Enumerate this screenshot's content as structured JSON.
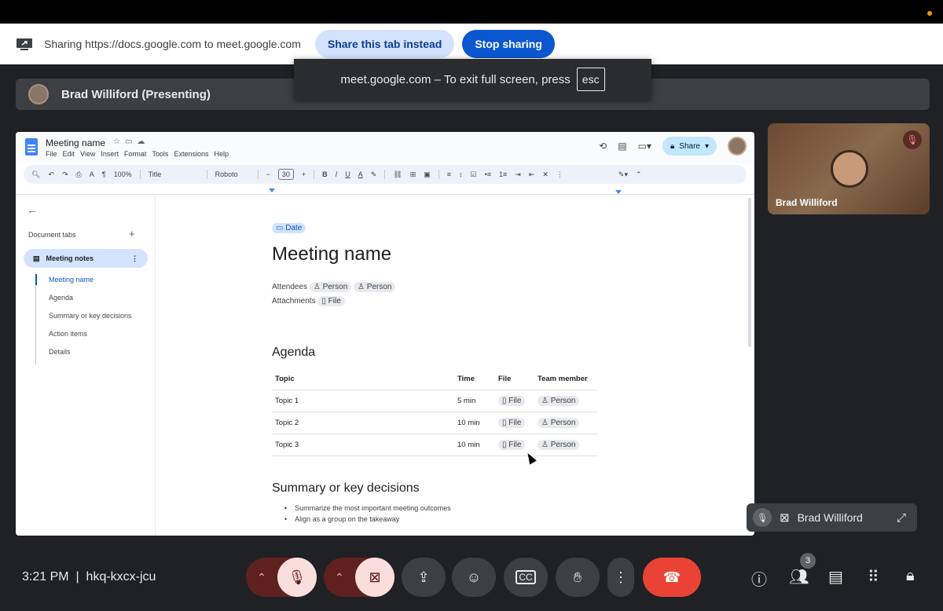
{
  "sharing_bar": {
    "text": "Sharing https://docs.google.com to meet.google.com",
    "share_tab_label": "Share this tab instead",
    "stop_label": "Stop sharing"
  },
  "presenter": {
    "name": "Brad Williford (Presenting)"
  },
  "fullscreen_toast": {
    "text": "meet.google.com – To exit full screen, press",
    "key": "esc"
  },
  "docs": {
    "title": "Meeting name",
    "menu": [
      "File",
      "Edit",
      "View",
      "Insert",
      "Format",
      "Tools",
      "Extensions",
      "Help"
    ],
    "share_label": "Share",
    "toolbar": {
      "zoom": "100%",
      "style": "Title",
      "font": "Roboto",
      "size": "30"
    },
    "outline": {
      "header": "Document tabs",
      "active_tab": "Meeting notes",
      "items": [
        "Meeting name",
        "Agenda",
        "Summary or key decisions",
        "Action items",
        "Details"
      ]
    },
    "page": {
      "date_chip": "Date",
      "heading": "Meeting name",
      "attendees_label": "Attendees",
      "person_chip": "Person",
      "attachments_label": "Attachments",
      "file_chip": "File",
      "agenda_heading": "Agenda",
      "agenda_columns": [
        "Topic",
        "Time",
        "File",
        "Team member"
      ],
      "agenda_rows": [
        {
          "topic": "Topic 1",
          "time": "5 min",
          "file": "File",
          "member": "Person"
        },
        {
          "topic": "Topic 2",
          "time": "10 min",
          "file": "File",
          "member": "Person"
        },
        {
          "topic": "Topic 3",
          "time": "10 min",
          "file": "File",
          "member": "Person"
        }
      ],
      "summary_heading": "Summary or key decisions",
      "summary_bullets": [
        "Summarize the most important meeting outcomes",
        "Align as a group on the takeaway"
      ]
    }
  },
  "participant_tile": {
    "name": "Brad Williford"
  },
  "self_view": {
    "name": "Brad Williford"
  },
  "bottom": {
    "time": "3:21 PM",
    "meeting_code": "hkq-kxcx-jcu",
    "people_count": "3"
  }
}
